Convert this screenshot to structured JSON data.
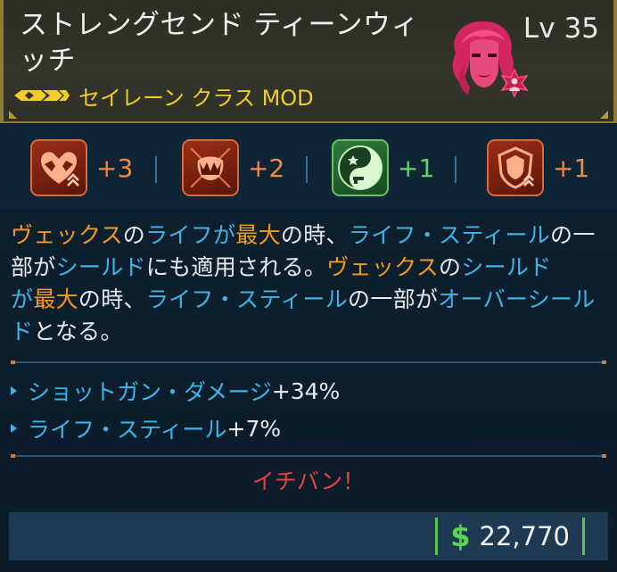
{
  "item": {
    "title": "ストレングセンド ティーンウィッチ",
    "level_label": "Lv",
    "level": "35",
    "type": "セイレーン クラス MOD",
    "rarity_icon": "legendary-rarity-chevrons",
    "rarity_color": "#f1cc2b"
  },
  "skills": [
    {
      "icon": "strength-heart-icon",
      "bonus": "+3",
      "color": "red"
    },
    {
      "icon": "fanged-mouth-icon",
      "bonus": "+2",
      "color": "red"
    },
    {
      "icon": "yin-yang-gun-icon",
      "bonus": "+1",
      "color": "green"
    },
    {
      "icon": "shield-crest-icon",
      "bonus": "+1",
      "color": "red"
    }
  ],
  "description": {
    "s1": "ヴェックス",
    "s2": "の",
    "s3": "ライフ",
    "s4": "が",
    "s5": "最大",
    "s6": "の時、",
    "s7": "ライフ・スティール",
    "s8": "の一部が",
    "s9": "シールド",
    "s10": "にも適用される。",
    "s11": "ヴェックス",
    "s12": "の",
    "s13": "シールド",
    "s14": "が",
    "s15": "最大",
    "s16": "の時、",
    "s17": "ライフ・スティール",
    "s18": "の一部が",
    "s19": "オーバーシールド",
    "s20": "となる。"
  },
  "stats": [
    {
      "name": "ショットガン・ダメージ",
      "value": "+34%"
    },
    {
      "name": "ライフ・スティール",
      "value": "+7%"
    }
  ],
  "flavor": "イチバン！",
  "price": {
    "currency_symbol": "$",
    "amount": "22,770"
  },
  "colors": {
    "orange_highlight": "#f39b1d",
    "blue_highlight": "#3fb4ea",
    "flavor_red": "#e8413f",
    "price_green": "#5cd452"
  }
}
